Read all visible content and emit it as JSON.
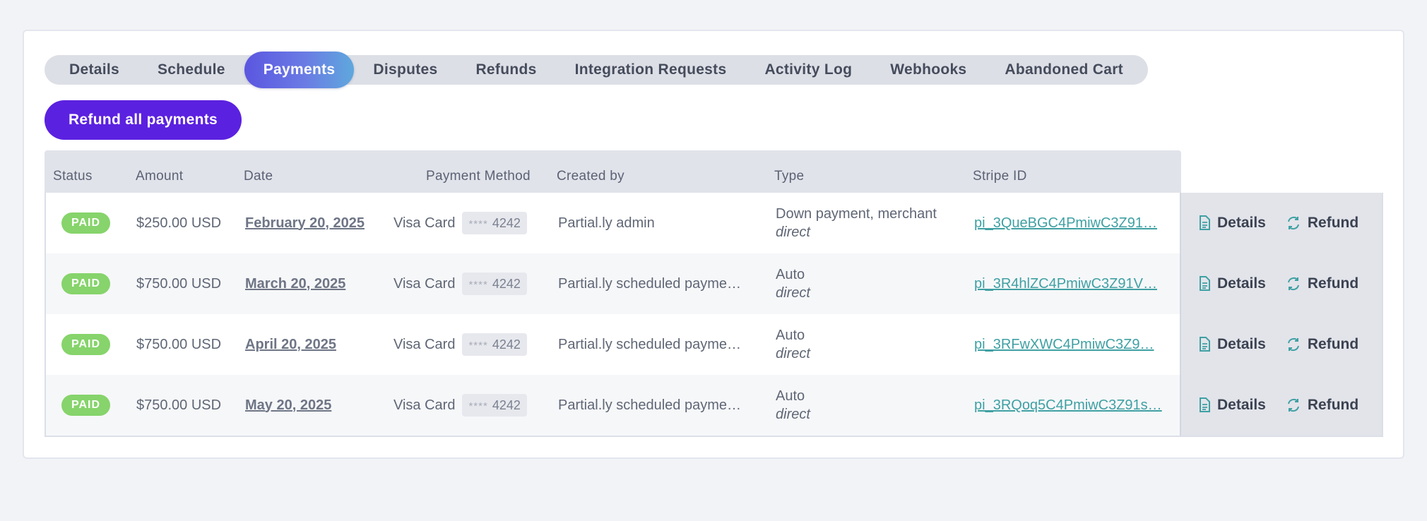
{
  "tabs": [
    {
      "label": "Details",
      "active": false
    },
    {
      "label": "Schedule",
      "active": false
    },
    {
      "label": "Payments",
      "active": true
    },
    {
      "label": "Disputes",
      "active": false
    },
    {
      "label": "Refunds",
      "active": false
    },
    {
      "label": "Integration Requests",
      "active": false
    },
    {
      "label": "Activity Log",
      "active": false
    },
    {
      "label": "Webhooks",
      "active": false
    },
    {
      "label": "Abandoned Cart",
      "active": false
    }
  ],
  "refund_all_label": "Refund all payments",
  "table": {
    "headers": {
      "status": "Status",
      "amount": "Amount",
      "date": "Date",
      "payment_method": "Payment Method",
      "created_by": "Created by",
      "type": "Type",
      "stripe_id": "Stripe ID"
    },
    "rows": [
      {
        "status": "PAID",
        "amount": "$250.00 USD",
        "date": "February 20, 2025",
        "method": "Visa Card",
        "mask": "****",
        "last4": "4242",
        "created_by": "Partial.ly admin",
        "type": "Down payment, merchant",
        "type_sub": "direct",
        "stripe_id": "pi_3QueBGC4PmiwC3Z91…"
      },
      {
        "status": "PAID",
        "amount": "$750.00 USD",
        "date": "March 20, 2025",
        "method": "Visa Card",
        "mask": "****",
        "last4": "4242",
        "created_by": "Partial.ly scheduled payme…",
        "type": "Auto",
        "type_sub": "direct",
        "stripe_id": "pi_3R4hlZC4PmiwC3Z91V…"
      },
      {
        "status": "PAID",
        "amount": "$750.00 USD",
        "date": "April 20, 2025",
        "method": "Visa Card",
        "mask": "****",
        "last4": "4242",
        "created_by": "Partial.ly scheduled payme…",
        "type": "Auto",
        "type_sub": "direct",
        "stripe_id": "pi_3RFwXWC4PmiwC3Z9…"
      },
      {
        "status": "PAID",
        "amount": "$750.00 USD",
        "date": "May 20, 2025",
        "method": "Visa Card",
        "mask": "****",
        "last4": "4242",
        "created_by": "Partial.ly scheduled payme…",
        "type": "Auto",
        "type_sub": "direct",
        "stripe_id": "pi_3RQoq5C4PmiwC3Z91s…"
      }
    ],
    "actions": {
      "details_label": "Details",
      "refund_label": "Refund",
      "details_icon": "document-icon",
      "refund_icon": "refresh-icon"
    }
  },
  "colors": {
    "accent": "#5b21e0",
    "tab_active_start": "#5b56e0",
    "tab_active_end": "#5fa8dd",
    "paid_badge": "#86d46b",
    "link_teal": "#3fa0a3"
  }
}
